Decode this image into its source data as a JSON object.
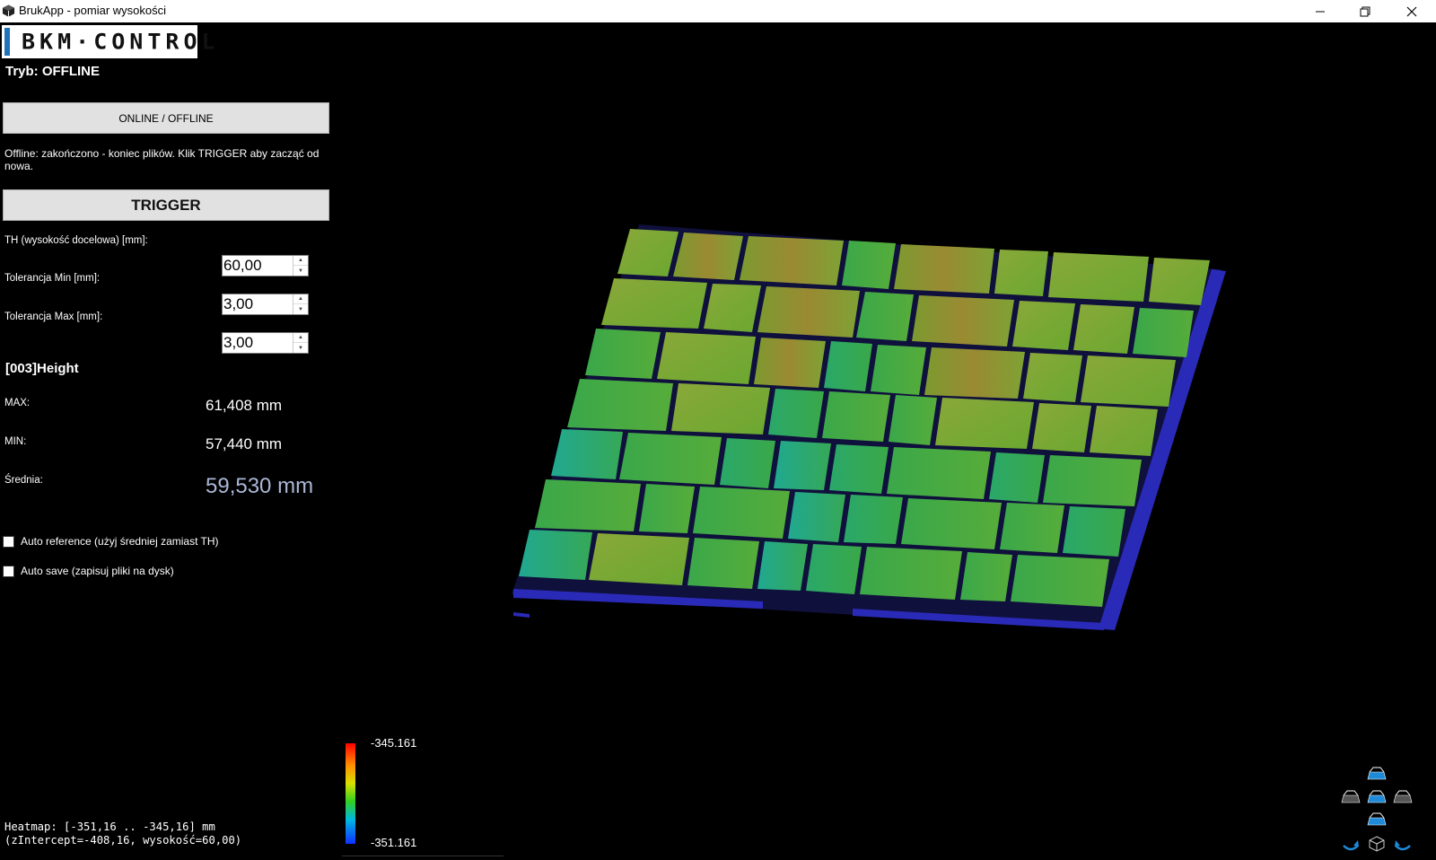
{
  "window": {
    "title": "BrukApp - pomiar wysokości"
  },
  "logo": {
    "text": "BKM·CONTROL"
  },
  "mode": {
    "label": "Tryb: OFFLINE"
  },
  "buttons": {
    "online_offline": "ONLINE / OFFLINE",
    "trigger": "TRIGGER"
  },
  "status_message": "Offline: zakończono - koniec plików. Klik TRIGGER aby zacząć od nowa.",
  "fields": {
    "th_label": "TH (wysokość docelowa) [mm]:",
    "th_value": "60,00",
    "tol_min_label": "Tolerancja Min [mm]:",
    "tol_min_value": "3,00",
    "tol_max_label": "Tolerancja Max [mm]:",
    "tol_max_value": "3,00"
  },
  "height": {
    "title": "[003]Height",
    "max_label": "MAX:",
    "max_value": "61,408 mm",
    "min_label": "MIN:",
    "min_value": "57,440 mm",
    "avg_label": "Średnia:",
    "avg_value": "59,530 mm"
  },
  "options": {
    "auto_reference": "Auto reference (użyj średniej zamiast TH)",
    "auto_save": "Auto save (zapisuj pliki na dysk)"
  },
  "heatmap": {
    "line1": "Heatmap: [-351,16 .. -345,16] mm",
    "line2": "(zIntercept=-408,16, wysokość=60,00)",
    "scale_max": "-345.161",
    "scale_min": "-351.161"
  },
  "colors": {
    "button_bg": "#e1e1e1",
    "avg_value": "#aab8d6",
    "pallet": "#2a2ab8",
    "accent": "#1e73b9"
  }
}
